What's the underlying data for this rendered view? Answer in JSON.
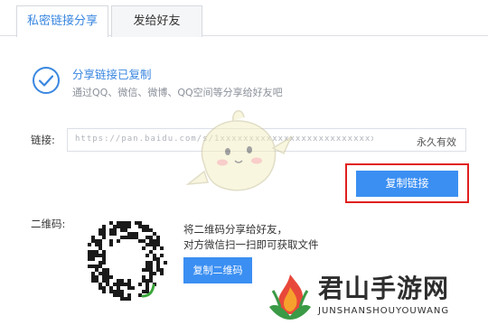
{
  "tabs": [
    {
      "label": "私密链接分享",
      "active": true
    },
    {
      "label": "发给好友",
      "active": false
    }
  ],
  "success": {
    "icon": "check-circle-icon",
    "title": "分享链接已复制",
    "subtitle": "通过QQ、微信、微博、QQ空间等分享给好友吧"
  },
  "link": {
    "label": "链接:",
    "value": "https://pan.baidu.com/s/1xxxxxxxxxxxxxxxxxxxxxxxxxxxx",
    "validity": "永久有效",
    "copy_button": "复制链接"
  },
  "qrcode": {
    "label": "二维码:",
    "hint_line1": "将二维码分享给好友，",
    "hint_line2": "对方微信扫一扫即可获取文件",
    "copy_button": "复制二维码"
  },
  "watermark": {
    "title": "君山手游网",
    "subtitle": "JUNSHANSHOUYOUWANG"
  },
  "colors": {
    "accent": "#3b8ff2",
    "highlight_border": "#e0201e"
  }
}
